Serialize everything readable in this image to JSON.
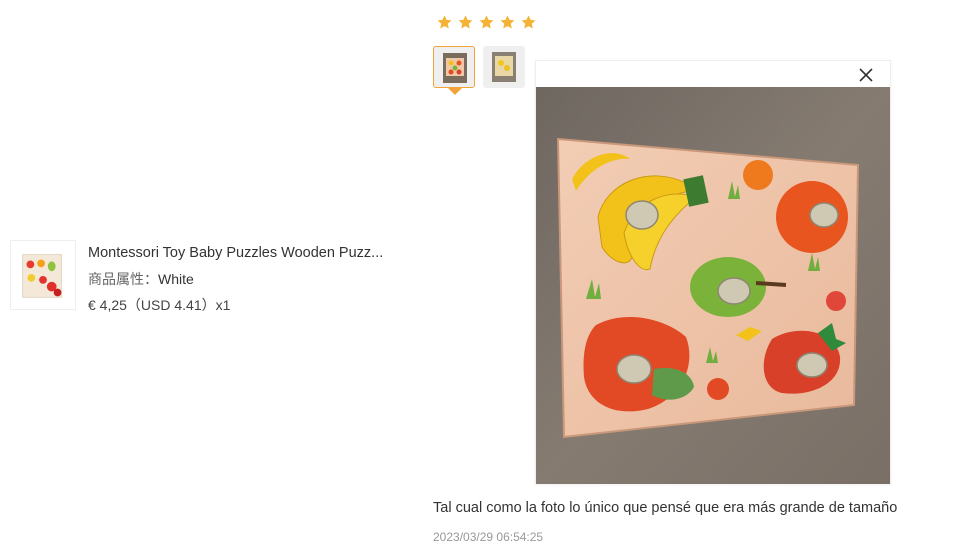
{
  "product": {
    "title": "Montessori Toy Baby Puzzles Wooden Puzz...",
    "attr_label": "商品属性：",
    "attr_value": "White",
    "price": "€ 4,25（USD  4.41）x1"
  },
  "review": {
    "rating": 5,
    "star_color": "#f5b335",
    "text": "Tal cual como la foto lo único que pensé que era más grande de tamaño",
    "date": "2023/03/29 06:54:25"
  },
  "colors": {
    "accent": "#f2a33a"
  },
  "icons": {
    "close": "close-icon",
    "star": "star-icon"
  }
}
